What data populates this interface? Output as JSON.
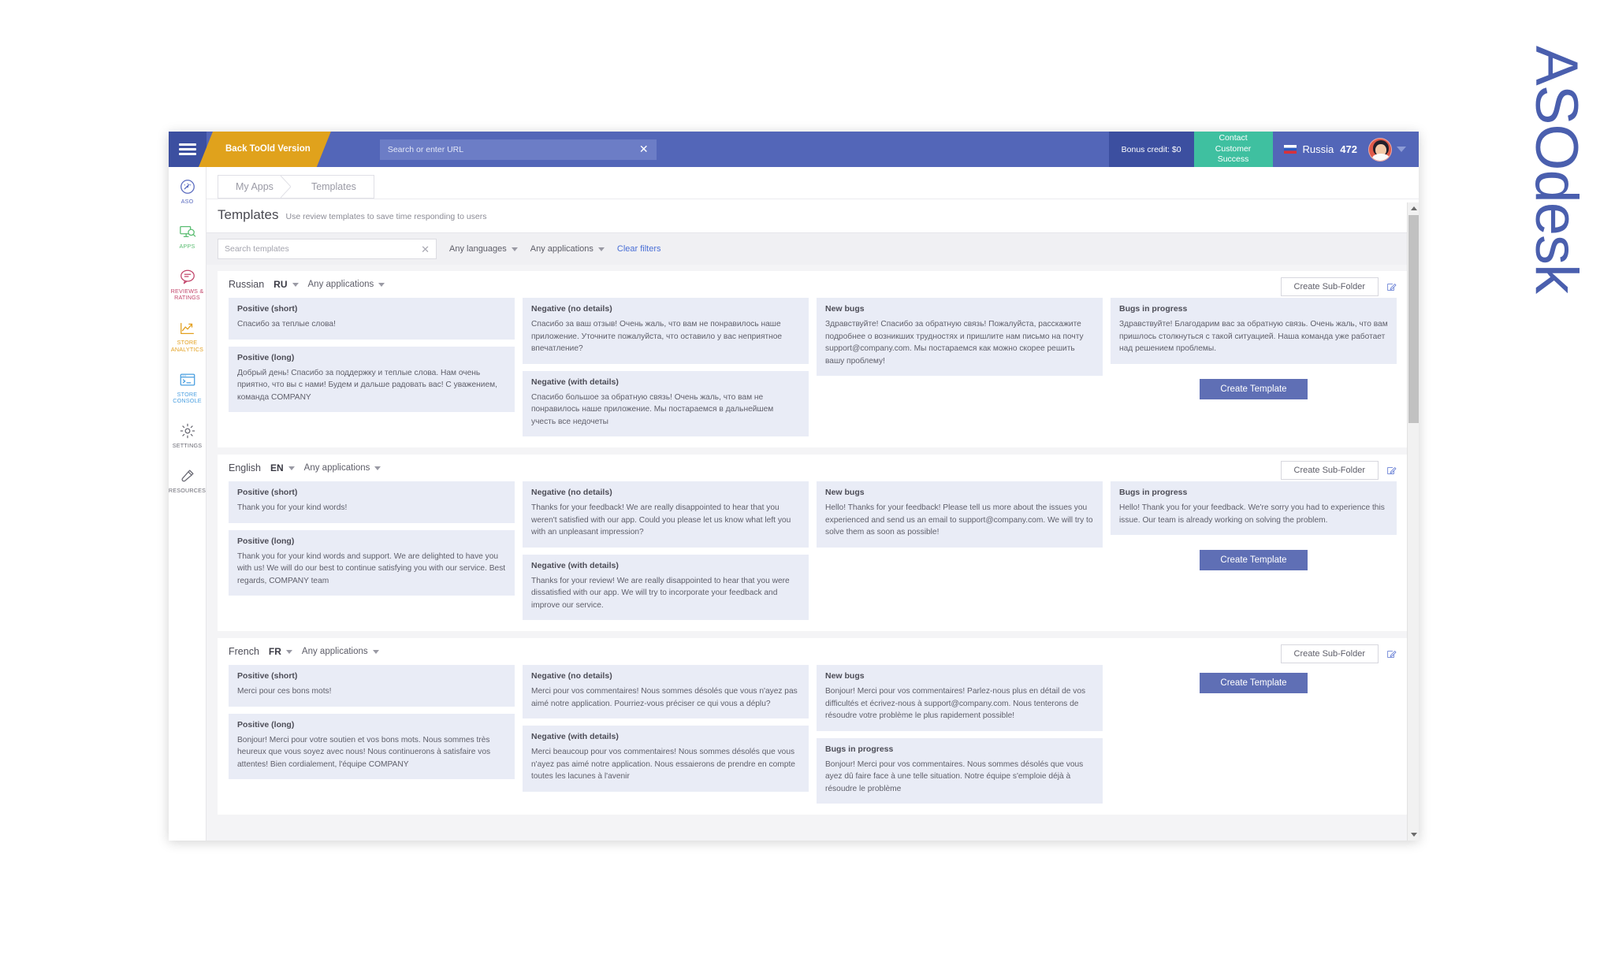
{
  "brand": {
    "name": "ASOdesk"
  },
  "topbar": {
    "menu_icon": "hamburger-icon",
    "back_old_version": "Back To\nOld Version",
    "back_old_line1": "Back To",
    "back_old_line2": "Old Version",
    "url_placeholder": "Search or enter URL",
    "url_value": "",
    "url_clear_icon": "close-icon",
    "bonus_credit": "Bonus credit: $0",
    "contact_cs_line1": "Contact",
    "contact_cs_line2": "Customer Success",
    "country_flag": "russia-flag-icon",
    "country_name": "Russia",
    "country_number": "472",
    "avatar_icon": "user-avatar",
    "profile_caret_icon": "chevron-down-icon",
    "accent_blue": "#5366b8",
    "accent_dark_blue": "#3c4fa0",
    "accent_orange": "#e0a21c",
    "accent_teal": "#3fc0a0"
  },
  "rail": {
    "items": [
      {
        "label": "ASO",
        "icon": "speedometer-icon",
        "color": "#5b6cc0"
      },
      {
        "label": "APPS",
        "icon": "monitor-search-icon",
        "color": "#5bbd72"
      },
      {
        "label": "REVIEWS &\nRATINGS",
        "line1": "REVIEWS &",
        "line2": "RATINGS",
        "icon": "chat-bubble-icon",
        "color": "#c2456b"
      },
      {
        "label": "STORE\nANALYTICS",
        "line1": "STORE",
        "line2": "ANALYTICS",
        "icon": "trend-chart-icon",
        "color": "#e3a01f"
      },
      {
        "label": "STORE\nCONSOLE",
        "line1": "STORE",
        "line2": "CONSOLE",
        "icon": "terminal-icon",
        "color": "#4a9fe0"
      },
      {
        "label": "SETTINGS",
        "line1": "SETTINGS",
        "line2": "",
        "icon": "gear-icon",
        "color": "#6a6a74"
      },
      {
        "label": "RESOURCES",
        "line1": "RESOURCES",
        "line2": "",
        "icon": "screwdriver-icon",
        "color": "#6a6a74"
      }
    ]
  },
  "tabs": [
    {
      "label": "My Apps",
      "active": false
    },
    {
      "label": "Templates",
      "active": true
    }
  ],
  "page": {
    "title": "Templates",
    "subtitle": "Use review templates to save time responding to users"
  },
  "filters": {
    "search_placeholder": "Search templates",
    "search_value": "",
    "search_clear_icon": "close-icon",
    "languages_label": "Any languages",
    "applications_label": "Any applications",
    "clear_filters_label": "Clear filters"
  },
  "common": {
    "create_subfolder_label": "Create Sub-Folder",
    "create_template_label": "Create Template",
    "edit_icon": "edit-pencil-icon",
    "any_applications_label": "Any applications"
  },
  "sections": [
    {
      "language": "Russian",
      "code": "RU",
      "applications": "Any applications",
      "cards": {
        "positive_short": {
          "title": "Positive (short)",
          "body": "Спасибо за теплые слова!"
        },
        "positive_long": {
          "title": "Positive (long)",
          "body": "Добрый день! Спасибо за поддержку и теплые слова. Нам очень приятно, что вы с нами! Будем и дальше радовать вас! С уважением, команда COMPANY"
        },
        "negative_no_details": {
          "title": "Negative (no details)",
          "body": "Спасибо за ваш отзыв! Очень жаль, что вам не понравилось наше приложение. Уточните пожалуйста, что оставило у вас неприятное впечатление?"
        },
        "negative_with_details": {
          "title": "Negative (with details)",
          "body": "Спасибо большое за обратную связь! Очень жаль, что вам не понравилось наше приложение. Мы постараемся в дальнейшем учесть все недочеты"
        },
        "new_bugs": {
          "title": "New bugs",
          "body": "Здравствуйте! Спасибо за обратную связь! Пожалуйста, расскажите подробнее о возникших трудностях и пришлите нам письмо на почту support@company.com. Мы постараемся как можно скорее решить вашу проблему!"
        },
        "bugs_in_progress": {
          "title": "Bugs in progress",
          "body": "Здравствуйте! Благодарим вас за обратную связь. Очень жаль, что вам пришлось столкнуться с такой ситуацией. Наша команда уже работает над решением проблемы."
        }
      }
    },
    {
      "language": "English",
      "code": "EN",
      "applications": "Any applications",
      "cards": {
        "positive_short": {
          "title": "Positive (short)",
          "body": "Thank you for your kind words!"
        },
        "positive_long": {
          "title": "Positive (long)",
          "body": "Thank you for your kind words and support. We are delighted to have you with us! We will do our best to continue satisfying you with our service. Best regards, COMPANY team"
        },
        "negative_no_details": {
          "title": "Negative (no details)",
          "body": "Thanks for your feedback! We are really disappointed to hear that you weren't satisfied with our app. Could you please let us know what left you with an unpleasant impression?"
        },
        "negative_with_details": {
          "title": "Negative (with details)",
          "body": "Thanks for your review! We are really disappointed to hear that you were dissatisfied with our app. We will try to incorporate your feedback and improve our service."
        },
        "new_bugs": {
          "title": "New bugs",
          "body": "Hello! Thanks for your feedback! Please tell us more about the issues you experienced and send us an email to support@company.com. We will try to solve them as soon as possible!"
        },
        "bugs_in_progress": {
          "title": "Bugs in progress",
          "body": "Hello! Thank you for your feedback. We're sorry you had to experience this issue. Our team is already working on solving the problem."
        }
      }
    },
    {
      "language": "French",
      "code": "FR",
      "applications": "Any applications",
      "cards": {
        "positive_short": {
          "title": "Positive (short)",
          "body": "Merci pour ces bons mots!"
        },
        "positive_long": {
          "title": "Positive (long)",
          "body": "Bonjour! Merci pour votre soutien et vos bons mots. Nous sommes très heureux que vous soyez avec nous! Nous continuerons à satisfaire vos attentes! Bien cordialement, l'équipe COMPANY"
        },
        "negative_no_details": {
          "title": "Negative (no details)",
          "body": "Merci pour vos commentaires! Nous sommes désolés que vous n'ayez pas aimé notre application. Pourriez-vous préciser ce qui vous a déplu?"
        },
        "negative_with_details": {
          "title": "Negative (with details)",
          "body": "Merci beaucoup pour vos commentaires! Nous sommes désolés que vous n'ayez pas aimé notre application. Nous essaierons de prendre en compte toutes les lacunes à l'avenir"
        },
        "new_bugs": {
          "title": "New bugs",
          "body": "Bonjour! Merci pour vos commentaires! Parlez-nous plus en détail de vos difficultés et écrivez-nous à support@company.com. Nous tenterons de résoudre votre problème le plus rapidement possible!"
        },
        "bugs_in_progress": {
          "title": "Bugs in progress",
          "body": "Bonjour! Merci pour vos commentaires. Nous sommes désolés que vous ayez dû faire face à une telle situation. Notre équipe s'emploie déjà à résoudre le problème"
        }
      }
    }
  ],
  "scrollbar": {
    "up_icon": "scroll-up-arrow-icon",
    "down_icon": "scroll-down-arrow-icon",
    "thumb": "scroll-thumb"
  }
}
